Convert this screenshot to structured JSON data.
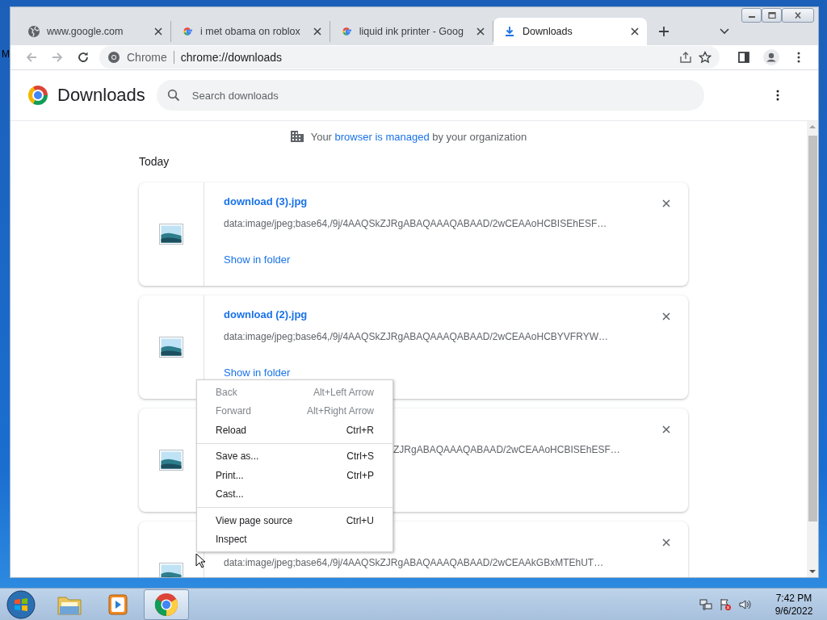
{
  "desktop": {
    "edge_text": "M"
  },
  "tabs": [
    {
      "kind": "globe",
      "title": "www.google.com",
      "selected": false
    },
    {
      "kind": "google",
      "title": "i met obama on roblox",
      "selected": false
    },
    {
      "kind": "google",
      "title": "liquid ink printer - Goog",
      "selected": false
    },
    {
      "kind": "download",
      "title": "Downloads",
      "selected": true
    }
  ],
  "toolbar": {
    "origin_label": "Chrome",
    "url": "chrome://downloads"
  },
  "page": {
    "title": "Downloads",
    "search": {
      "placeholder": "Search downloads"
    },
    "notice": {
      "before": "Your ",
      "link": "browser is managed",
      "after": " by your organization"
    },
    "section": "Today",
    "downloads": [
      {
        "name": "download (3).jpg",
        "url": "data:image/jpeg;base64,/9j/4AAQSkZJRgABAQAAAQABAAD/2wCEAAoHCBISEhESF…",
        "action": "Show in folder",
        "covered": false
      },
      {
        "name": "download (2).jpg",
        "url": "data:image/jpeg;base64,/9j/4AAQSkZJRgABAQAAAQABAAD/2wCEAAoHCBYVFRYW…",
        "action": "Show in folder",
        "covered": false
      },
      {
        "url": "ZJRgABAQAAAQABAAD/2wCEAAoHCBISEhESF…",
        "covered": true
      },
      {
        "url": "data:image/jpeg;base64,/9j/4AAQSkZJRgABAQAAAQABAAD/2wCEAAkGBxMTEhUT…",
        "covered": false
      }
    ]
  },
  "context_menu": [
    {
      "kind": "item",
      "label": "Back",
      "shortcut": "Alt+Left Arrow",
      "disabled": true
    },
    {
      "kind": "item",
      "label": "Forward",
      "shortcut": "Alt+Right Arrow",
      "disabled": true
    },
    {
      "kind": "item",
      "label": "Reload",
      "shortcut": "Ctrl+R",
      "disabled": false
    },
    {
      "kind": "separator"
    },
    {
      "kind": "item",
      "label": "Save as...",
      "shortcut": "Ctrl+S",
      "disabled": false
    },
    {
      "kind": "item",
      "label": "Print...",
      "shortcut": "Ctrl+P",
      "disabled": false
    },
    {
      "kind": "item",
      "label": "Cast...",
      "disabled": false
    },
    {
      "kind": "separator"
    },
    {
      "kind": "item",
      "label": "View page source",
      "shortcut": "Ctrl+U",
      "disabled": false
    },
    {
      "kind": "item",
      "label": "Inspect",
      "disabled": false
    }
  ],
  "taskbar": {
    "apps": [
      {
        "kind": "explorer",
        "selected": false
      },
      {
        "kind": "media",
        "selected": false
      },
      {
        "kind": "chrome",
        "selected": true
      }
    ],
    "time": "7:42 PM",
    "date": "9/6/2022"
  }
}
